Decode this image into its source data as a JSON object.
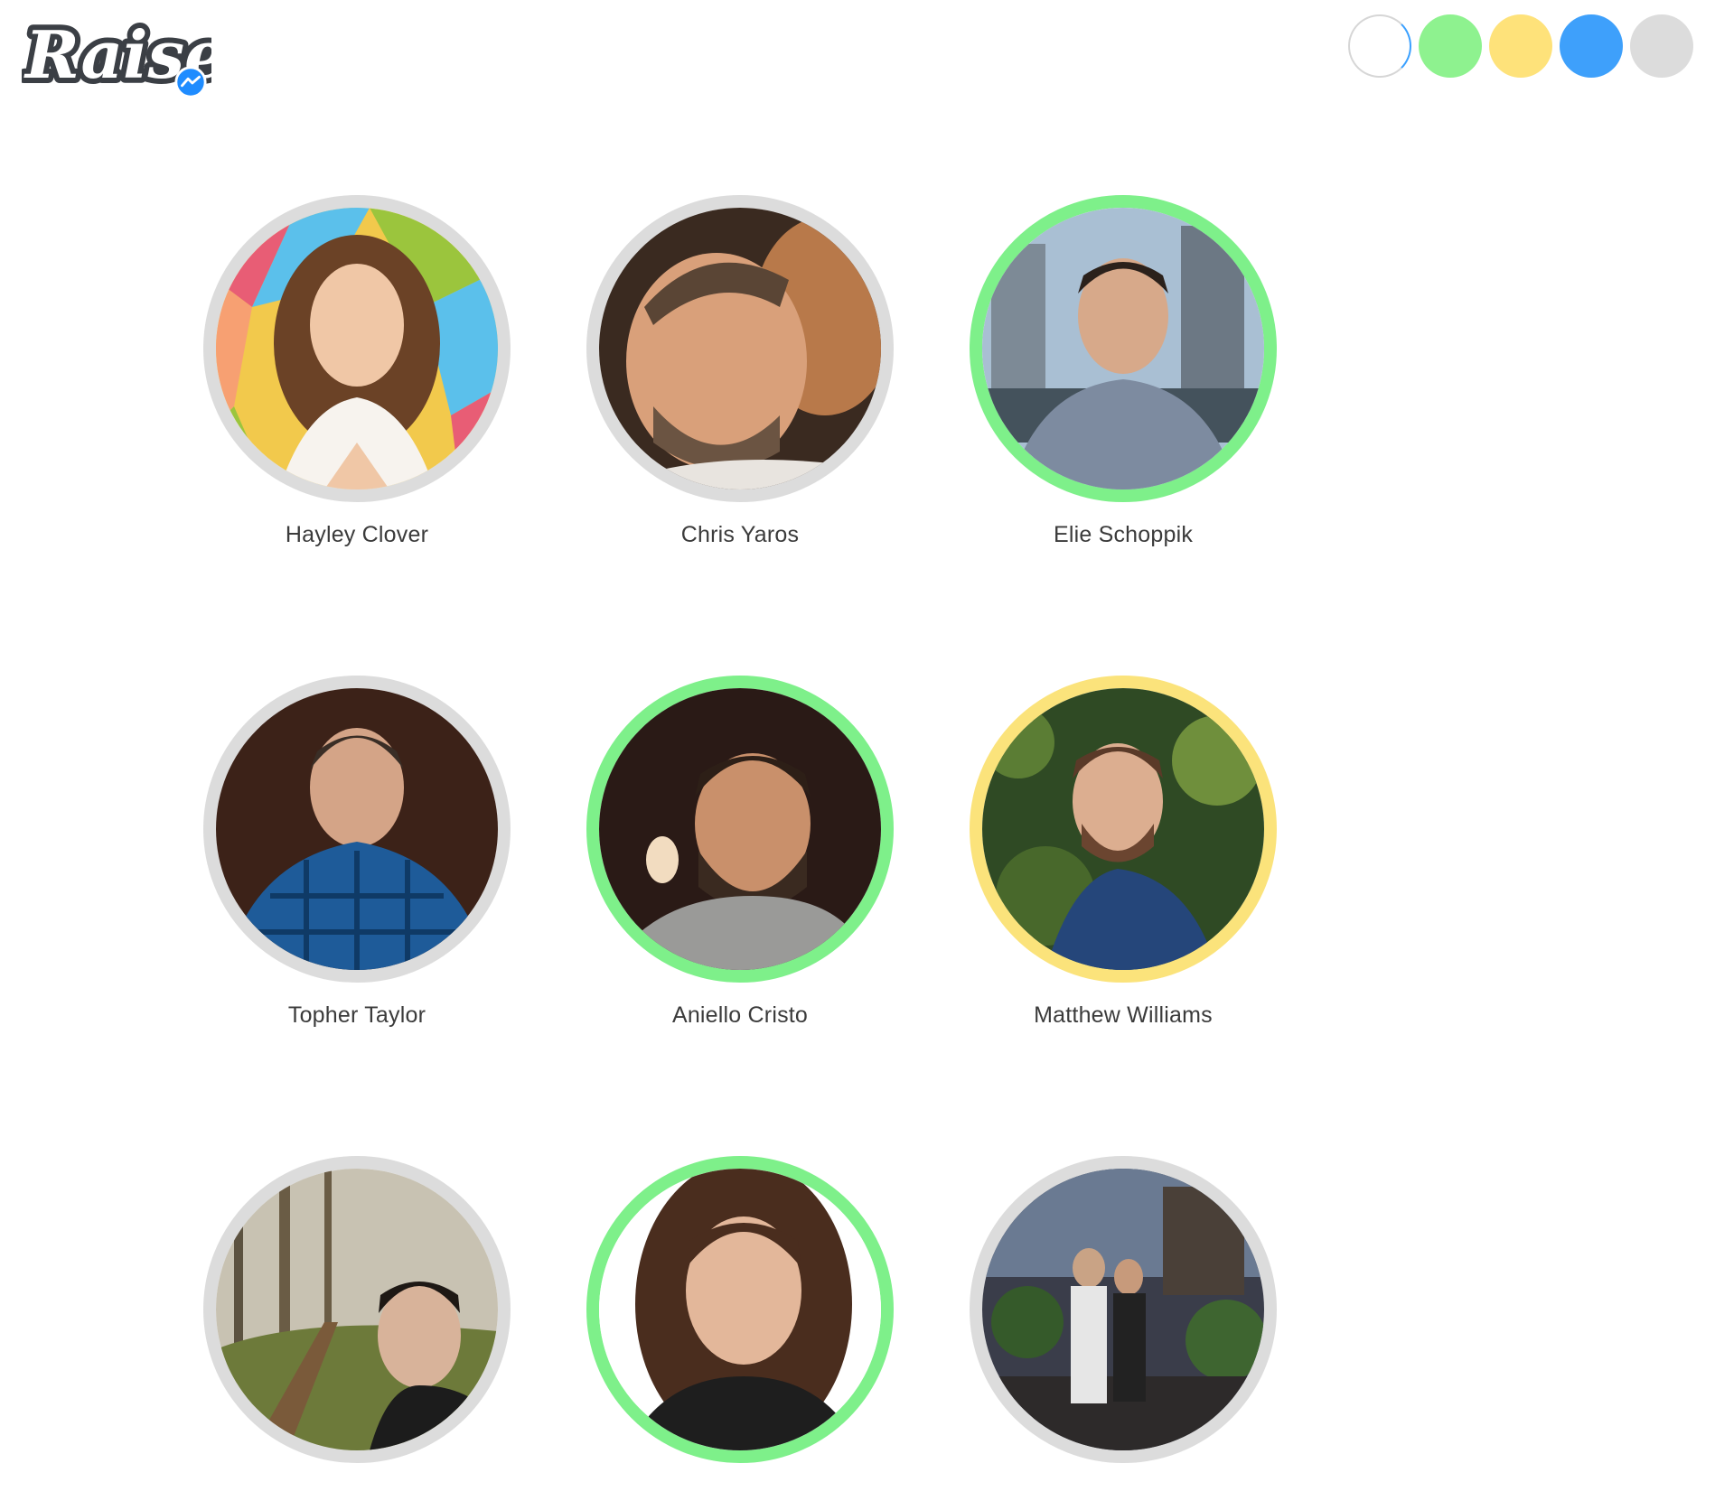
{
  "logo": {
    "text": "Raise",
    "badge_icon": "messenger-icon"
  },
  "filters": [
    {
      "name": "all",
      "color": "#ffffff",
      "active": true
    },
    {
      "name": "green",
      "color": "#8ef28f"
    },
    {
      "name": "yellow",
      "color": "#fee27a"
    },
    {
      "name": "blue",
      "color": "#3ea0fb"
    },
    {
      "name": "gray",
      "color": "#dcdcdc"
    }
  ],
  "ring_colors": {
    "gray": "#dcdcdc",
    "green": "#7ef08a",
    "yellow": "#fbe37b"
  },
  "people": [
    {
      "name": "Hayley Clover",
      "ring": "gray"
    },
    {
      "name": "Chris Yaros",
      "ring": "gray"
    },
    {
      "name": "Elie Schoppik",
      "ring": "green"
    },
    {
      "name": "Topher Taylor",
      "ring": "gray"
    },
    {
      "name": "Aniello Cristo",
      "ring": "green"
    },
    {
      "name": "Matthew Williams",
      "ring": "yellow"
    },
    {
      "name": "",
      "ring": "gray"
    },
    {
      "name": "",
      "ring": "green"
    },
    {
      "name": "",
      "ring": "gray"
    }
  ]
}
